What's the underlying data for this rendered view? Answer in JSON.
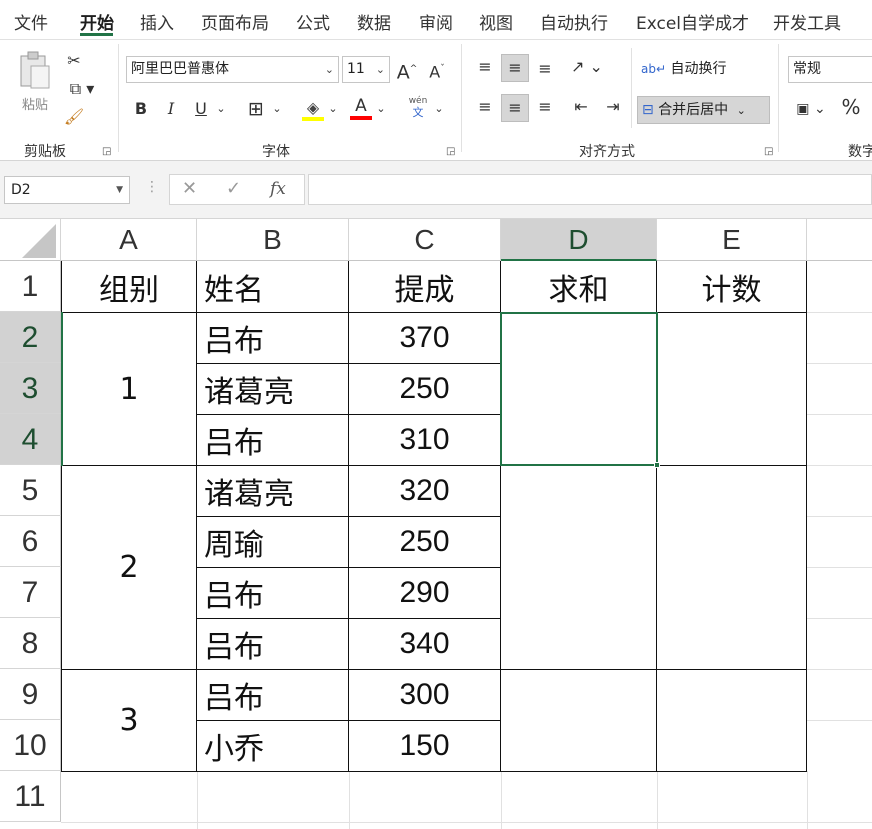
{
  "menu": {
    "tabs": [
      "文件",
      "开始",
      "插入",
      "页面布局",
      "公式",
      "数据",
      "审阅",
      "视图",
      "自动执行",
      "Excel自学成才",
      "开发工具"
    ],
    "active": "开始"
  },
  "ribbon": {
    "clipboard": {
      "paste_label": "粘贴",
      "group_label": "剪贴板"
    },
    "font": {
      "font_name": "阿里巴巴普惠体",
      "font_size": "11",
      "group_label": "字体",
      "bold": "B",
      "italic": "I",
      "underline": "U",
      "phonetic": "wén"
    },
    "alignment": {
      "wrap_text": "自动换行",
      "merge_center": "合并后居中",
      "group_label": "对齐方式"
    },
    "number": {
      "format": "常规",
      "percent": "%",
      "group_label": "数字"
    },
    "colors": {
      "accent": "#217346",
      "highlight": "#ffff00",
      "font_color": "#ff0000"
    }
  },
  "formula_bar": {
    "name_box": "D2",
    "fx": "fx",
    "formula": ""
  },
  "columns": [
    "A",
    "B",
    "C",
    "D",
    "E"
  ],
  "rows": [
    "1",
    "2",
    "3",
    "4",
    "5",
    "6",
    "7",
    "8",
    "9",
    "10",
    "11"
  ],
  "headers": {
    "group": "组别",
    "name": "姓名",
    "commission": "提成",
    "sum": "求和",
    "count": "计数"
  },
  "groups": [
    "1",
    "2",
    "3"
  ],
  "names": [
    "吕布",
    "诸葛亮",
    "吕布",
    "诸葛亮",
    "周瑜",
    "吕布",
    "吕布",
    "吕布",
    "小乔"
  ],
  "values": [
    "370",
    "250",
    "310",
    "320",
    "250",
    "290",
    "340",
    "300",
    "150"
  ]
}
